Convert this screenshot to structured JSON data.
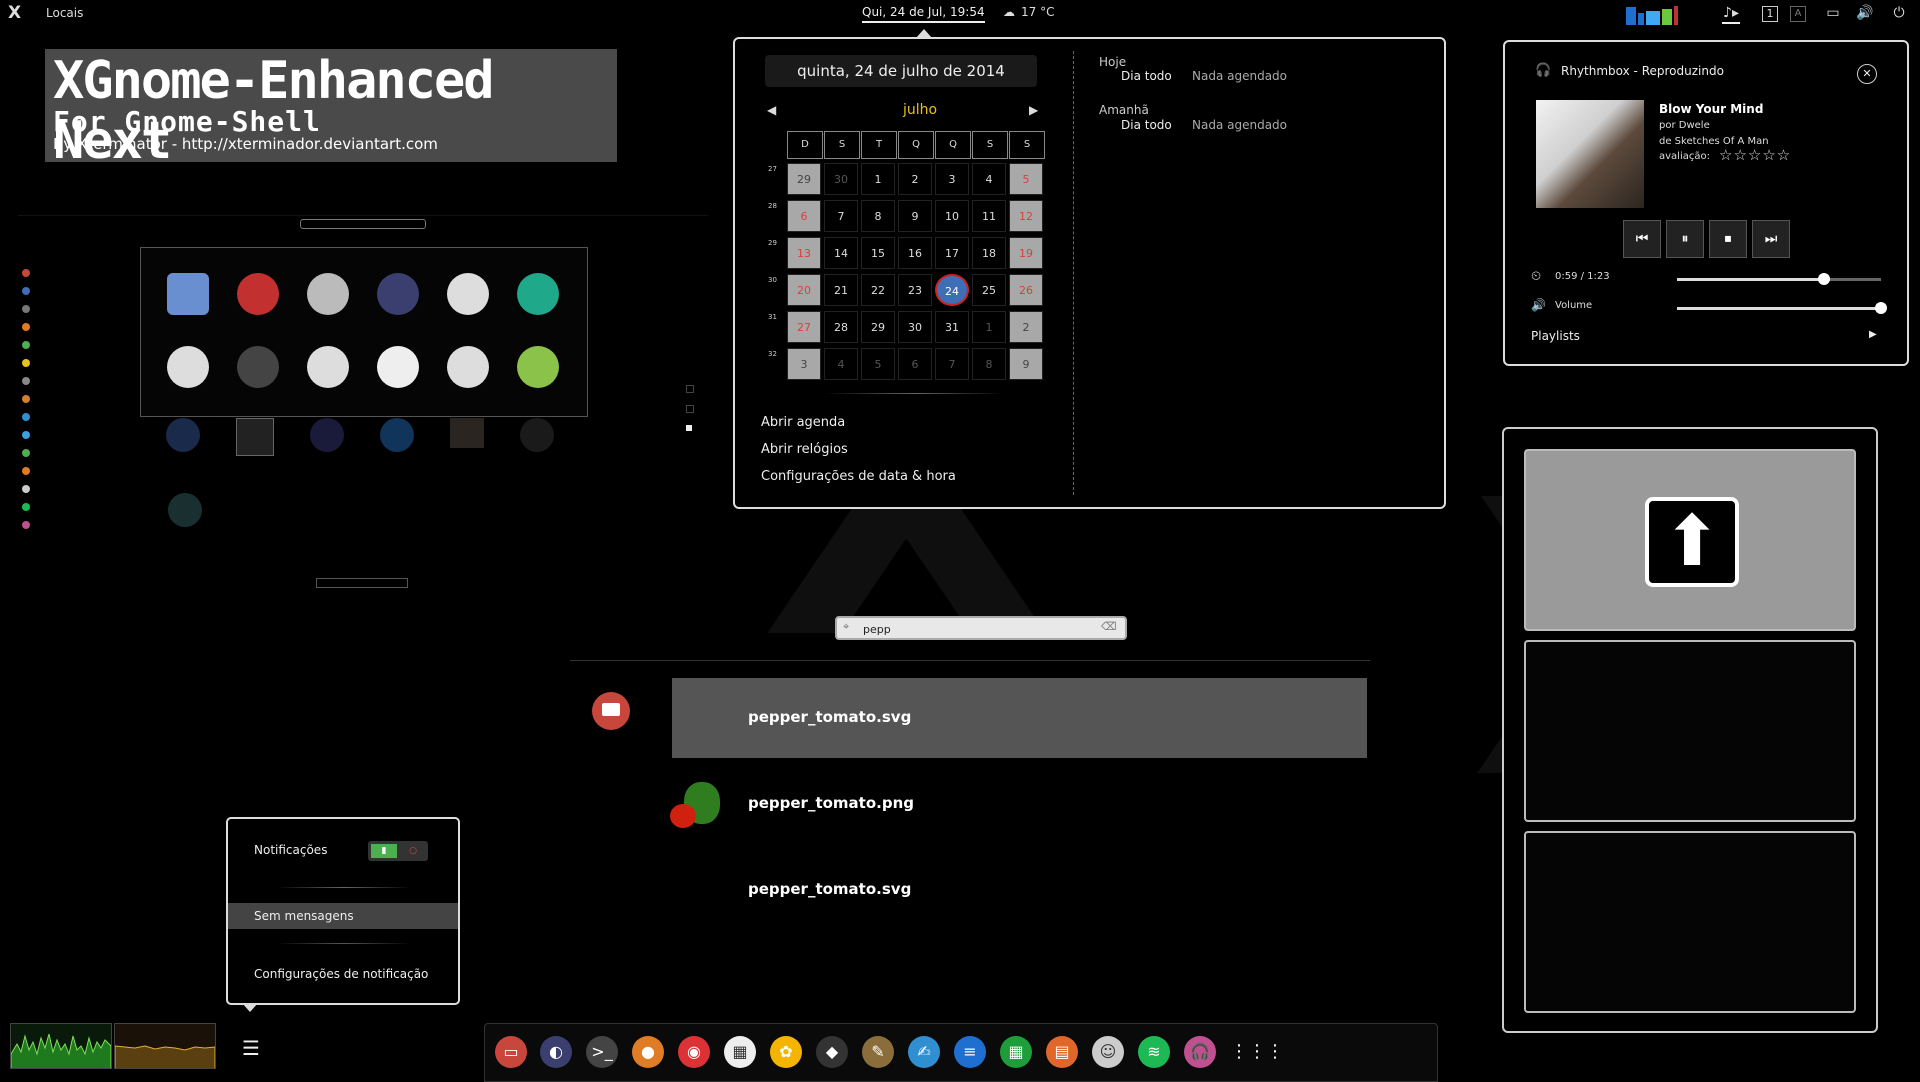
{
  "topbar": {
    "logo": "X",
    "places": "Locais",
    "clock": "Qui, 24 de Jul, 19:54",
    "weather": "17 °C"
  },
  "banner": {
    "title": "XGnome-Enhanced Next",
    "subtitle": "For Gnome-Shell",
    "credit": "By Xterminator - http://xterminador.deviantart.com"
  },
  "calendar": {
    "date_header": "quinta, 24 de julho de 2014",
    "month": "julho",
    "weekdays": [
      "D",
      "S",
      "T",
      "Q",
      "Q",
      "S",
      "S"
    ],
    "weeks": [
      {
        "num": "27",
        "days": [
          "29",
          "30",
          "1",
          "2",
          "3",
          "4",
          "5"
        ]
      },
      {
        "num": "28",
        "days": [
          "6",
          "7",
          "8",
          "9",
          "10",
          "11",
          "12"
        ]
      },
      {
        "num": "29",
        "days": [
          "13",
          "14",
          "15",
          "16",
          "17",
          "18",
          "19"
        ]
      },
      {
        "num": "30",
        "days": [
          "20",
          "21",
          "22",
          "23",
          "24",
          "25",
          "26"
        ]
      },
      {
        "num": "31",
        "days": [
          "27",
          "28",
          "29",
          "30",
          "31",
          "1",
          "2"
        ]
      },
      {
        "num": "32",
        "days": [
          "3",
          "4",
          "5",
          "6",
          "7",
          "8",
          "9"
        ]
      }
    ],
    "today": "24",
    "events": {
      "today_label": "Hoje",
      "today_time": "Dia todo",
      "today_text": "Nada agendado",
      "tomorrow_label": "Amanhã",
      "tomorrow_time": "Dia todo",
      "tomorrow_text": "Nada agendado"
    },
    "links": [
      "Abrir agenda",
      "Abrir relógios",
      "Configurações de data & hora"
    ]
  },
  "rhythmbox": {
    "title": "Rhythmbox - Reproduzindo",
    "song": "Blow Your Mind",
    "artist": "por Dwele",
    "album": "de Sketches Of A Man",
    "rating_label": "avaliação:",
    "stars": "☆☆☆☆☆",
    "time": "0:59 / 1:23",
    "progress": 0.72,
    "volume_label": "Volume",
    "volume": 1.0,
    "playlists": "Playlists"
  },
  "search": {
    "query": "pepp"
  },
  "results": [
    "pepper_tomato.svg",
    "pepper_tomato.png",
    "pepper_tomato.svg"
  ],
  "notifications": {
    "label": "Notificações",
    "empty": "Sem mensagens",
    "settings": "Configurações de notificação"
  },
  "colors": {
    "accent_month": "#e6c21f",
    "weekend": "#e03c3c",
    "today": "#3e6eb5"
  }
}
